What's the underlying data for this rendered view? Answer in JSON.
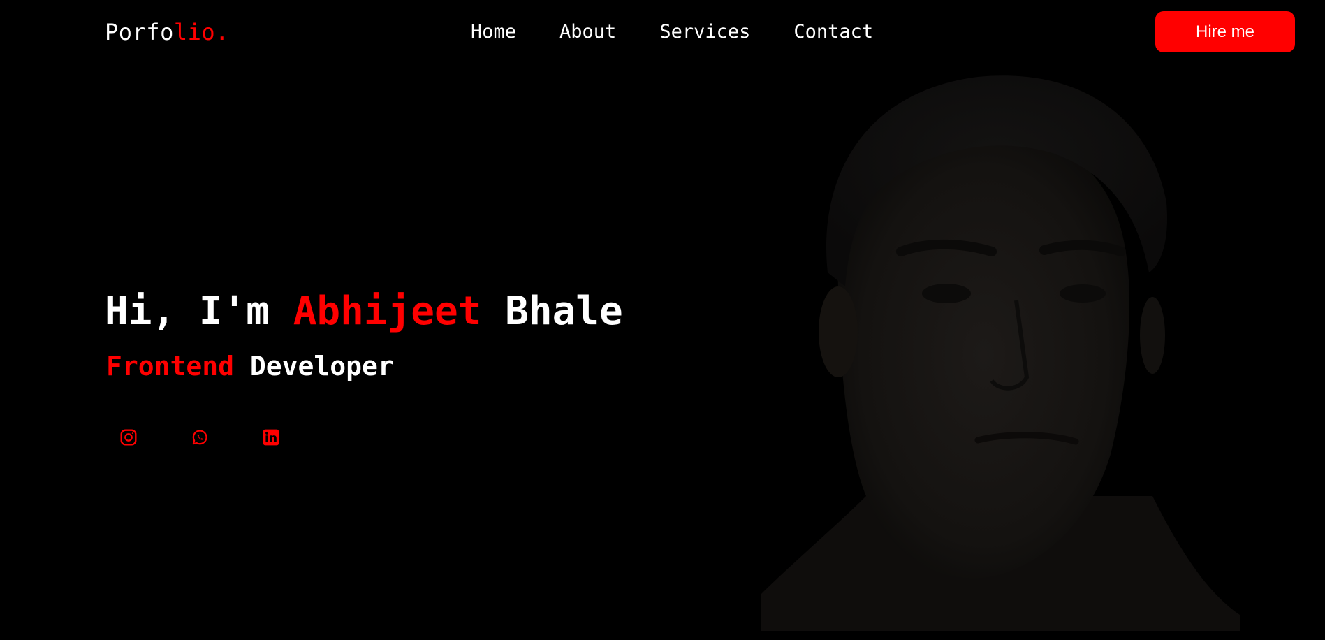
{
  "header": {
    "logo": {
      "prefix": "Porfo",
      "accent": "lio."
    },
    "nav": [
      {
        "label": "Home"
      },
      {
        "label": "About"
      },
      {
        "label": "Services"
      },
      {
        "label": "Contact"
      }
    ],
    "cta_label": "Hire me"
  },
  "hero": {
    "title": {
      "greeting": "Hi, I'm ",
      "first_name": "Abhijeet",
      "last_name": " Bhale"
    },
    "subtitle": {
      "accent": "Frontend",
      "rest": " Developer"
    },
    "socials": [
      {
        "icon": "instagram-icon"
      },
      {
        "icon": "whatsapp-icon"
      },
      {
        "icon": "linkedin-icon"
      }
    ],
    "photo": {
      "icon": "portrait-photo"
    }
  },
  "colors": {
    "background": "#000000",
    "accent": "#ff0000",
    "text": "#ffffff"
  }
}
